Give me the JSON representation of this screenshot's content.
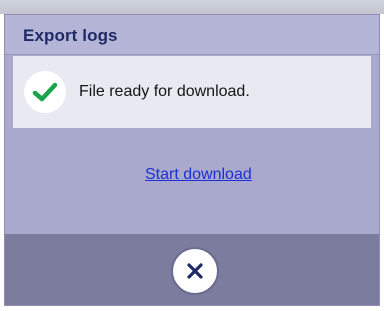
{
  "dialog": {
    "title": "Export logs",
    "message": "File ready for download.",
    "link_label": "Start download",
    "status_icon": "checkmark-icon",
    "close_icon": "close-icon"
  },
  "colors": {
    "title_text": "#1f2a66",
    "check_green": "#19a34a",
    "link": "#1b2fd6",
    "footer": "#7c7c9f"
  }
}
